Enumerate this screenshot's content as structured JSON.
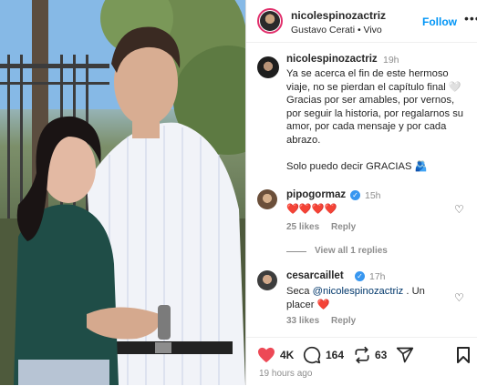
{
  "header": {
    "username": "nicolespinozactriz",
    "subtitle": "Gustavo Cerati • Vivo",
    "follow_label": "Follow",
    "more_label": "•••"
  },
  "caption": {
    "username": "nicolespinozactriz",
    "time": "19h",
    "text": "Ya se acerca el fin de este hermoso viaje, no se pierdan el capítulo final 🤍 Gracias por ser amables, por vernos, por seguir la historia, por regalarnos su amor, por cada mensaje y por cada abrazo.\n\nSolo puedo decir GRACIAS 🫂"
  },
  "comments": [
    {
      "username": "pipogormaz",
      "verified": true,
      "time": "15h",
      "text": "❤️❤️❤️❤️",
      "likes": "25 likes",
      "reply": "Reply",
      "view_replies": "View all 1 replies"
    },
    {
      "username": "cesarcaillet",
      "verified": true,
      "time": "17h",
      "text_prefix": "Seca ",
      "mention": "@nicolespinozactriz",
      "text_suffix": " . Un placer ❤️",
      "likes": "33 likes",
      "reply": "Reply"
    }
  ],
  "actions": {
    "likes_count": "4K",
    "comments_count": "164",
    "reposts_count": "63",
    "like_color": "#ed4956"
  },
  "date": "19 hours ago"
}
